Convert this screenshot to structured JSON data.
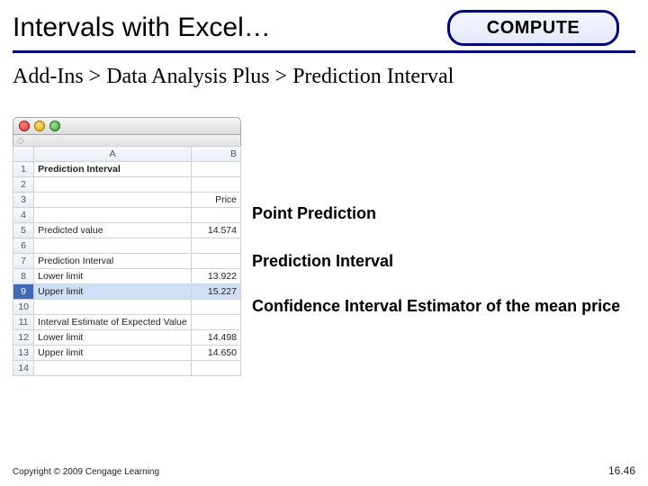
{
  "header": {
    "title": "Intervals with Excel…",
    "badge": "COMPUTE"
  },
  "path": "Add-Ins > Data Analysis Plus > Prediction Interval",
  "excel": {
    "toolbar_diamond": "◇",
    "columns": {
      "A": "A",
      "B": "B"
    },
    "rows": [
      {
        "n": "1",
        "A": "Prediction Interval",
        "B": "",
        "boldA": true
      },
      {
        "n": "2",
        "A": "",
        "B": ""
      },
      {
        "n": "3",
        "A": "",
        "B": "Price"
      },
      {
        "n": "4",
        "A": "",
        "B": ""
      },
      {
        "n": "5",
        "A": "Predicted value",
        "B": "14.574"
      },
      {
        "n": "6",
        "A": "",
        "B": ""
      },
      {
        "n": "7",
        "A": "Prediction Interval",
        "B": ""
      },
      {
        "n": "8",
        "A": "Lower limit",
        "B": "13.922"
      },
      {
        "n": "9",
        "A": "Upper limit",
        "B": "15.227",
        "selected": true
      },
      {
        "n": "10",
        "A": "",
        "B": ""
      },
      {
        "n": "11",
        "A": "Interval Estimate of Expected Value",
        "B": ""
      },
      {
        "n": "12",
        "A": "Lower limit",
        "B": "14.498"
      },
      {
        "n": "13",
        "A": "Upper limit",
        "B": "14.650"
      },
      {
        "n": "14",
        "A": "",
        "B": ""
      }
    ]
  },
  "annotations": {
    "point": "Point Prediction",
    "pi": "Prediction Interval",
    "ci": "Confidence Interval Estimator of the mean price"
  },
  "footer": {
    "copyright": "Copyright © 2009 Cengage Learning",
    "page": "16.46"
  }
}
